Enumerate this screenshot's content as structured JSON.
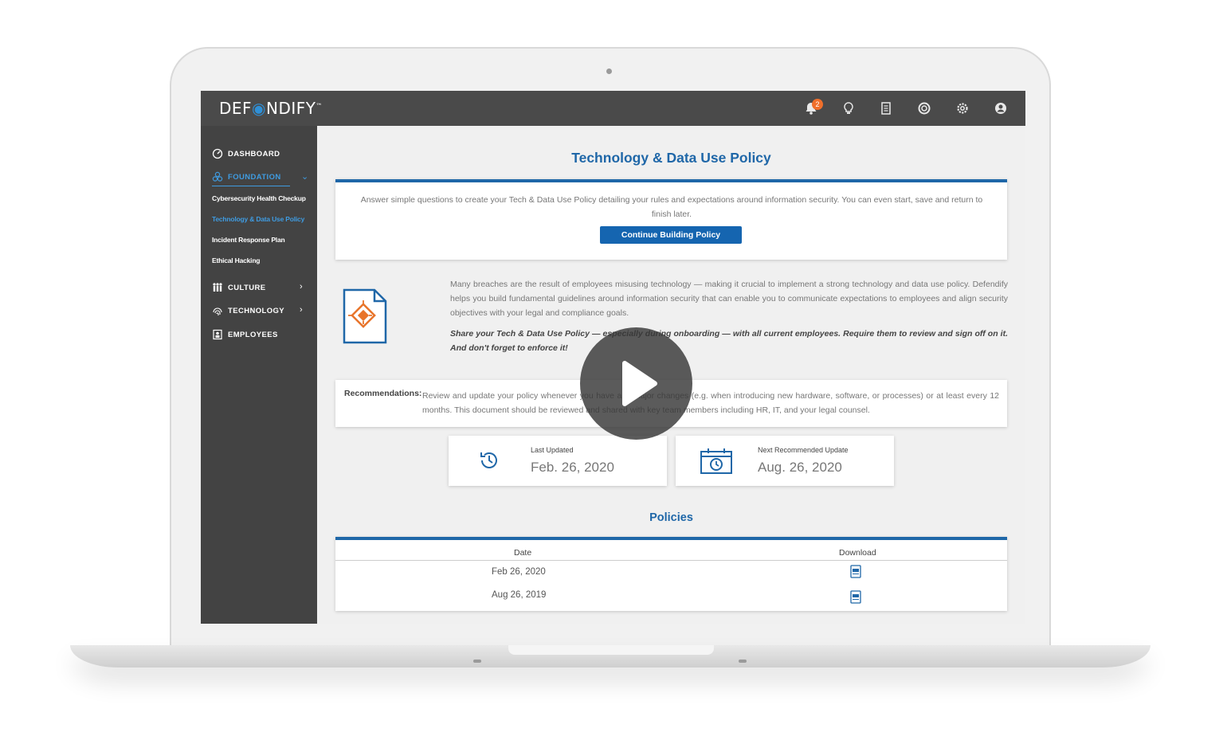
{
  "app": {
    "logo_text_before": "DEF",
    "logo_text_after": "NDIFY",
    "logo_tm": "™",
    "notifications_count": "2",
    "icons": [
      "bell-icon",
      "lightbulb-icon",
      "book-icon",
      "lifebuoy-icon",
      "gear-icon",
      "user-icon"
    ]
  },
  "sidebar": {
    "dashboard": "DASHBOARD",
    "foundation": "FOUNDATION",
    "foundation_items": [
      "Cybersecurity Health Checkup",
      "Technology & Data Use Policy",
      "Incident Response Plan",
      "Ethical Hacking"
    ],
    "culture": "CULTURE",
    "technology": "TECHNOLOGY",
    "employees": "EMPLOYEES"
  },
  "page": {
    "title": "Technology & Data Use Policy",
    "intro": "Answer simple questions to create your Tech & Data Use Policy detailing your rules and expectations around information security. You can even start, save and return to finish later.",
    "continue_button": "Continue Building Policy",
    "description": "Many breaches are the result of employees misusing technology — making it crucial to implement a strong technology and data use policy. Defendify helps you build fundamental guidelines around information security that can enable you to communicate expectations to employees and align security objectives with your legal and compliance goals.",
    "emphasis": "Share your Tech & Data Use Policy — especially during onboarding — with all current employees. Require them to review and sign off on it. And don't forget to enforce it!",
    "recommendations_label": "Recommendations:",
    "recommendations_text": "Review and update your policy whenever you have any major changes (e.g. when introducing new hardware, software, or processes) or at least every 12 months. This document should be reviewed and shared with key team members including HR, IT, and your legal counsel.",
    "last_updated_label": "Last Updated",
    "last_updated_value": "Feb. 26, 2020",
    "next_update_label": "Next Recommended Update",
    "next_update_value": "Aug. 26, 2020"
  },
  "policies": {
    "title": "Policies",
    "columns": [
      "Date",
      "Download"
    ],
    "rows": [
      {
        "date": "Feb 26, 2020",
        "download": "pdf-icon"
      },
      {
        "date": "Aug 26, 2019",
        "download": "pdf-icon"
      }
    ]
  },
  "colors": {
    "brand_blue": "#1f67a8",
    "sidebar_bg": "#434343",
    "topbar_bg": "#4a4a4a",
    "active_blue": "#3f9be0",
    "badge_orange": "#f06f2b",
    "icon_orange": "#e8742a"
  },
  "overlay": {
    "play_icon": "play-icon"
  }
}
